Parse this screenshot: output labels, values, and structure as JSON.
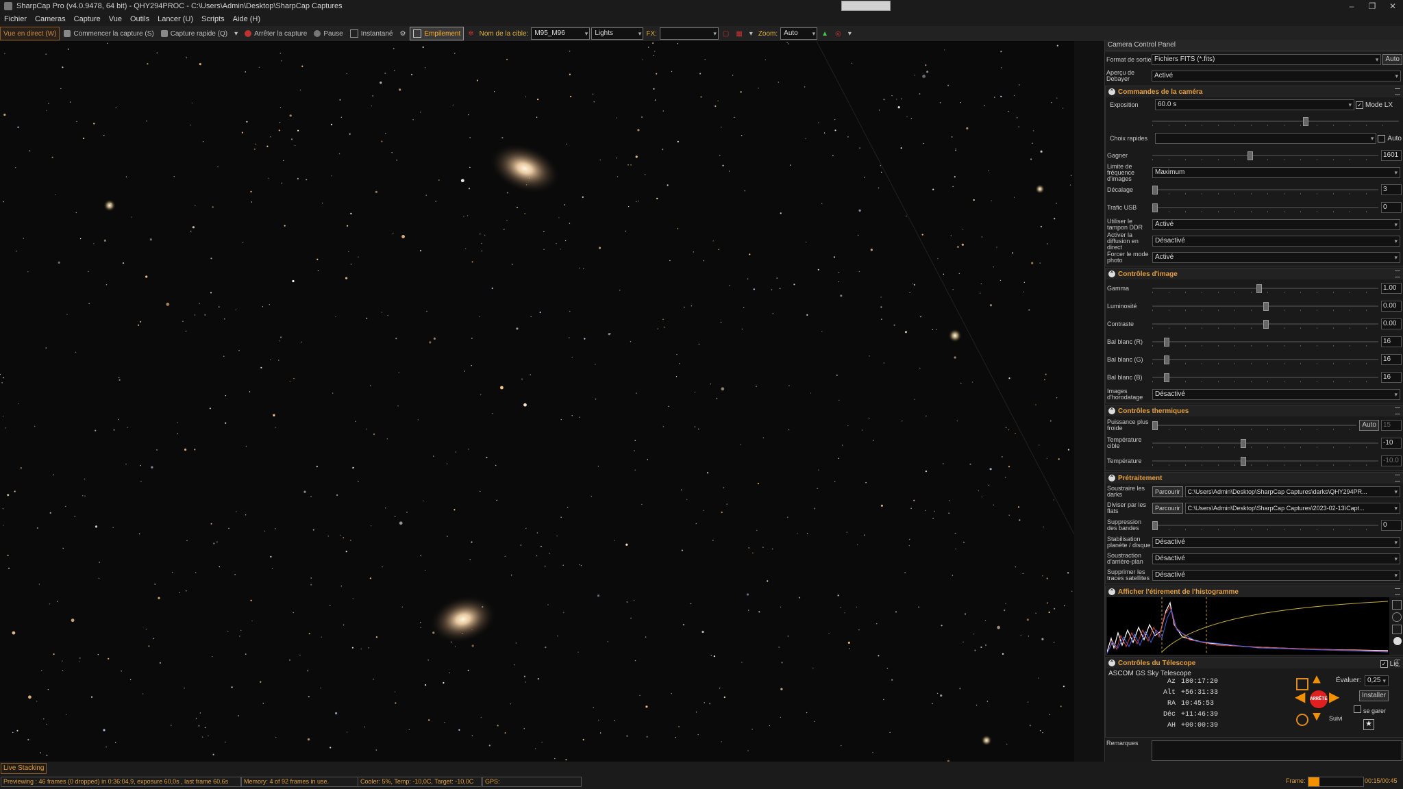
{
  "window": {
    "title": "SharpCap Pro (v4.0.9478, 64 bit) - QHY294PROC - C:\\Users\\Admin\\Desktop\\SharpCap Captures"
  },
  "menu": [
    "Fichier",
    "Cameras",
    "Capture",
    "Vue",
    "Outils",
    "Lancer (U)",
    "Scripts",
    "Aide (H)"
  ],
  "toolbar": {
    "live_view": "Vue en direct (W)",
    "start_capture": "Commencer la capture (S)",
    "quick_capture": "Capture rapide (Q)",
    "stop_capture": "Arrêter la capture",
    "pause": "Pause",
    "snapshot": "Instantané",
    "stacking": "Empilement",
    "target_label": "Nom de la cible:",
    "target_value": "M95_M96",
    "frame_type": "Lights",
    "fx_label": "FX:",
    "fx_value": "",
    "zoom_label": "Zoom:",
    "zoom_value": "Auto"
  },
  "panel": {
    "title": "Camera Control Panel",
    "output_format_label": "Format de sortie",
    "output_format_value": "Fichiers FITS (*.fits)",
    "output_format_auto": "Auto",
    "debayer_label": "Aperçu de Debayer",
    "debayer_value": "Activé",
    "camera": {
      "header": "Commandes de la caméra",
      "exposure_label": "Exposition",
      "exposure_value": "60.0 s",
      "lx_label": "Mode LX",
      "quick_label": "Choix rapides",
      "quick_auto": "Auto",
      "gain_label": "Gagner",
      "gain_value": "1601",
      "gain_level": 0.43,
      "framelimit_label": "Limite de fréquence d'images",
      "framelimit_value": "Maximum",
      "offset_label": "Décalage",
      "offset_value": "3",
      "offset_level": 0.01,
      "usb_label": "Trafic USB",
      "usb_value": "0",
      "usb_level": 0.0,
      "ddr_label": "Utiliser le tampon DDR",
      "ddr_value": "Activé",
      "livebc_label": "Activer la diffusion en direct",
      "livebc_value": "Désactivé",
      "photo_label": "Forcer le mode photo",
      "photo_value": "Activé"
    },
    "image": {
      "header": "Contrôles d'image",
      "gamma_label": "Gamma",
      "gamma_value": "1.00",
      "gamma_level": 0.47,
      "lum_label": "Luminosité",
      "lum_value": "0.00",
      "lum_level": 0.5,
      "con_label": "Contraste",
      "con_value": "0.00",
      "con_level": 0.5,
      "wbr_label": "Bal blanc (R)",
      "wbr_value": "16",
      "wbr_level": 0.06,
      "wbg_label": "Bal blanc (G)",
      "wbg_value": "16",
      "wbg_level": 0.06,
      "wbb_label": "Bal blanc (B)",
      "wbb_value": "16",
      "wbb_level": 0.06,
      "ts_label": "Images d'horodatage",
      "ts_value": "Désactivé"
    },
    "thermal": {
      "header": "Contrôles thermiques",
      "cool_label": "Puissance plus froide",
      "cool_auto": "Auto",
      "cool_value": "15",
      "cool_level": 0.0,
      "target_label": "Température cible",
      "target_value": "-10",
      "target_level": 0.4,
      "temp_label": "Température",
      "temp_value": "-10.0",
      "temp_level": 0.4
    },
    "preprocess": {
      "header": "Prétraitement",
      "darks_label": "Soustraire les darks",
      "browse": "Parcourir",
      "darks_path": "C:\\Users\\Admin\\Desktop\\SharpCap Captures\\darks\\QHY294PR...",
      "flats_label": "Diviser par les flats",
      "flats_path": "C:\\Users\\Admin\\Desktop\\SharpCap Captures\\2023-02-13\\Capt...",
      "banding_label": "Suppression des bandes",
      "banding_value": "0",
      "banding_level": 0.0,
      "stab_label": "Stabilisation planète / disque",
      "stab_value": "Désactivé",
      "bg_label": "Soustraction d'arrière-plan",
      "bg_value": "Désactivé",
      "sat_label": "Supprimer les traces satellites",
      "sat_value": "Désactivé"
    },
    "histogram": {
      "header": "Afficher l'étirement de l'histogramme"
    },
    "telescope": {
      "header": "Contrôles du Télescope",
      "name": "ASCOM GS Sky Telescope",
      "linked_label": "Lié",
      "rate_label": "Évaluer:",
      "rate_value": "0,25",
      "install_label": "Installer",
      "park_label": "se garer",
      "follow_label": "Suivi",
      "stop_label": "ARRÊTE",
      "coords": [
        {
          "k": "Az",
          "v": "180:17:20"
        },
        {
          "k": "Alt",
          "v": "+56:31:33"
        },
        {
          "k": "RA",
          "v": "10:45:53"
        },
        {
          "k": "Déc",
          "v": "+11:46:39"
        },
        {
          "k": "AH",
          "v": "+00:00:39"
        }
      ]
    },
    "notes_label": "Remarques"
  },
  "status": {
    "live_tab": "Live Stacking",
    "preview": "Previewing : 46 frames (0 dropped) in 0:36:04,9, exposure 60,0s , last frame 60,6s",
    "memory": "Memory: 4 of 92 frames in use.",
    "cooler": "Cooler: 5%, Temp: -10,0C, Target: -10,0C",
    "gps": "GPS:",
    "frame_label": "Frame:",
    "frame_progress": 0.2,
    "time": "00:15/00:45"
  },
  "colors": {
    "accent": "#e6a040",
    "progress": "#f29000",
    "stop": "#e02020"
  }
}
